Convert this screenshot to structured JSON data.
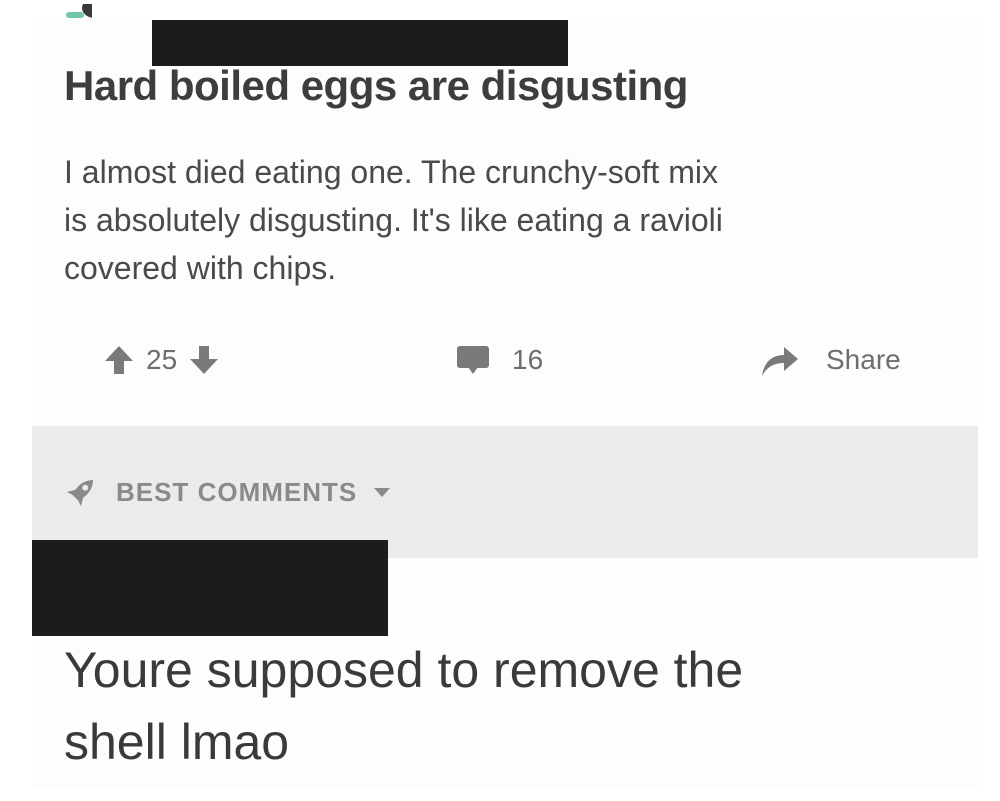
{
  "post": {
    "title": "Hard boiled eggs are disgusting",
    "body": "I almost died eating one. The crunchy-soft mix\nis absolutely disgusting. It's like eating a ravioli\ncovered with chips."
  },
  "actions": {
    "upvote_icon": "arrow-up-icon",
    "vote_count": "25",
    "downvote_icon": "arrow-down-icon",
    "comment_icon": "speech-bubble-icon",
    "comment_count": "16",
    "share_icon": "share-arrow-icon",
    "share_label": "Share"
  },
  "comments_section": {
    "sort_icon": "rocket-icon",
    "sort_label": "BEST COMMENTS",
    "dropdown_icon": "caret-down-icon"
  },
  "comment": {
    "text": "Youre supposed to remove the\nshell lmao"
  },
  "colors": {
    "text_primary": "#3d3d3d",
    "text_secondary": "#6e6e6e",
    "bar_background": "#ebebeb",
    "redaction": "#1c1c1c",
    "accent": "#6fc6ad"
  }
}
